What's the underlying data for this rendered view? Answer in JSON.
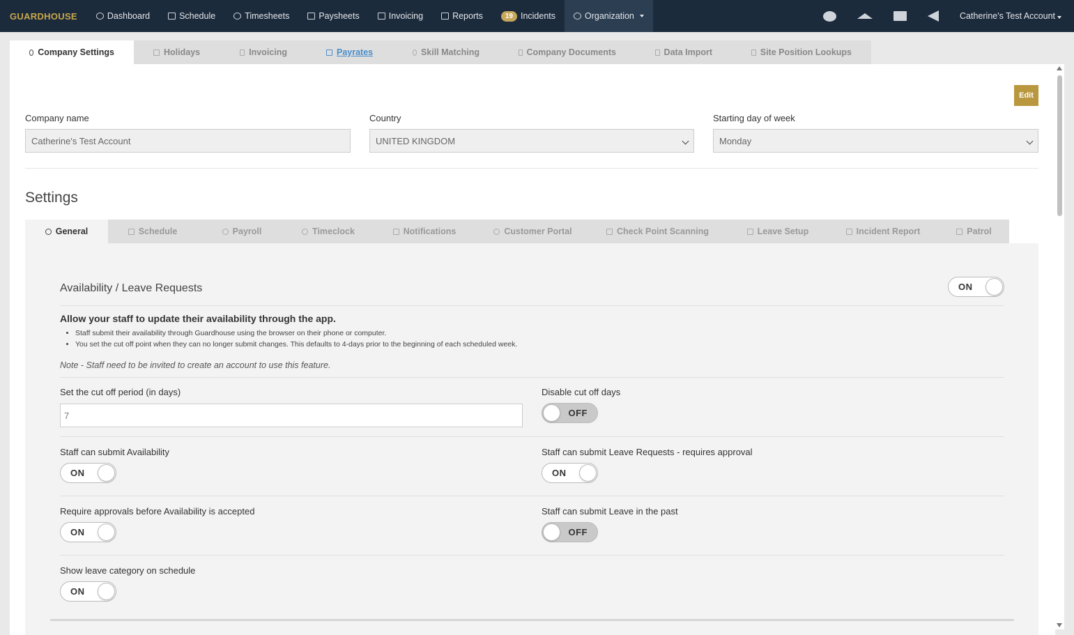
{
  "nav": {
    "brand": "GUARDHOUSE",
    "items": [
      {
        "label": "Dashboard",
        "icon": "dashboard-icon"
      },
      {
        "label": "Schedule",
        "icon": "calendar-icon"
      },
      {
        "label": "Timesheets",
        "icon": "clock-icon"
      },
      {
        "label": "Paysheets",
        "icon": "money-icon"
      },
      {
        "label": "Invoicing",
        "icon": "invoice-icon"
      },
      {
        "label": "Reports",
        "icon": "table-icon"
      },
      {
        "label": "Incidents",
        "badge": "19"
      },
      {
        "label": "Organization",
        "icon": "users-icon"
      }
    ],
    "account_label": "Catherine's Test Account"
  },
  "page_tabs": [
    {
      "label": "Company Settings",
      "icon": "gear-icon"
    },
    {
      "label": "Holidays",
      "icon": "star-icon"
    },
    {
      "label": "Invoicing",
      "icon": "invoice-icon"
    },
    {
      "label": "Payrates",
      "icon": "calendar-icon"
    },
    {
      "label": "Skill Matching",
      "icon": "crosshair-icon"
    },
    {
      "label": "Company Documents",
      "icon": "copy-icon"
    },
    {
      "label": "Data Import",
      "icon": "copy-icon"
    },
    {
      "label": "Site Position Lookups",
      "icon": "list-icon"
    }
  ],
  "company": {
    "edit_label": "Edit",
    "name_label": "Company name",
    "name_value": "Catherine's Test Account",
    "country_label": "Country",
    "country_value": "UNITED KINGDOM",
    "start_day_label": "Starting day of week",
    "start_day_value": "Monday"
  },
  "settings": {
    "title": "Settings",
    "tabs": [
      {
        "label": "General",
        "icon": "gear-icon"
      },
      {
        "label": "Schedule",
        "icon": "calendar-icon"
      },
      {
        "label": "Payroll",
        "icon": "user-icon"
      },
      {
        "label": "Timeclock",
        "icon": "clock-icon"
      },
      {
        "label": "Notifications",
        "icon": "bell-icon"
      },
      {
        "label": "Customer Portal",
        "icon": "user-icon"
      },
      {
        "label": "Check Point Scanning",
        "icon": "file-icon"
      },
      {
        "label": "Leave Setup",
        "icon": "file-icon"
      },
      {
        "label": "Incident Report",
        "icon": "file-icon"
      },
      {
        "label": "Patrol",
        "icon": "car-icon"
      }
    ],
    "section": {
      "title": "Availability / Leave Requests",
      "toggle": "ON",
      "headline": "Allow your staff to update their availability through the app.",
      "bullets": [
        "Staff submit their availability through Guardhouse using the browser on their phone or computer.",
        "You set the cut off point when they can no longer submit changes. This defaults to 4-days prior to the beginning of each scheduled week."
      ],
      "note": "Note - Staff need to be invited to create an account to use this feature.",
      "cutoff_label": "Set the cut off period (in days)",
      "cutoff_value": "7",
      "disable_cutoff_label": "Disable cut off days",
      "disable_cutoff_toggle": "OFF",
      "submit_availability_label": "Staff can submit Availability",
      "submit_availability_toggle": "ON",
      "submit_leave_label": "Staff can submit Leave Requests - requires approval",
      "submit_leave_toggle": "ON",
      "require_approvals_label": "Require approvals before Availability is accepted",
      "require_approvals_toggle": "ON",
      "leave_past_label": "Staff can submit Leave in the past",
      "leave_past_toggle": "OFF",
      "show_category_label": "Show leave category on schedule",
      "show_category_toggle": "ON"
    }
  }
}
